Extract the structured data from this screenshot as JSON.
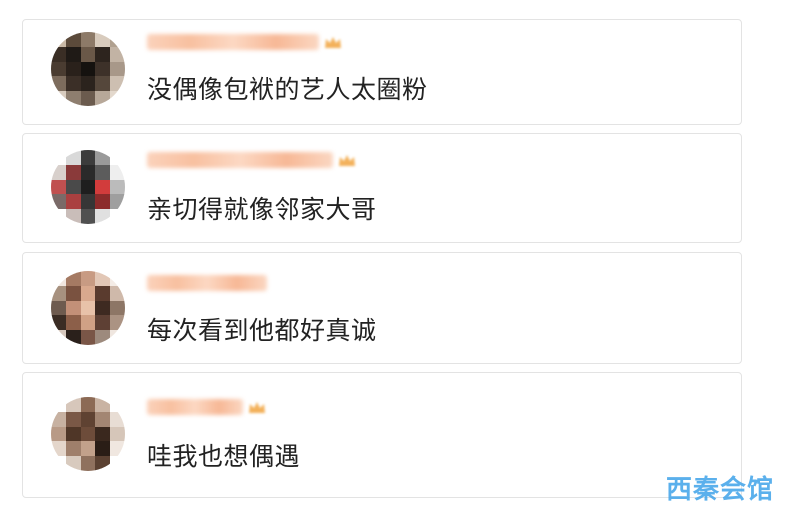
{
  "comments": [
    {
      "text": "没偶像包袱的艺人太圈粉",
      "username_redacted": true,
      "has_badge": true,
      "avatar": [
        "#c9b9a6",
        "#5b4a3a",
        "#8d7a68",
        "#d8cbbd",
        "#b0a08f",
        "#3a2e25",
        "#1f1a16",
        "#6a5848",
        "#2d241e",
        "#c2b3a4",
        "#4a3c31",
        "#2a211b",
        "#15120f",
        "#3d3129",
        "#a89889",
        "#7d6c5d",
        "#3b2f27",
        "#2b231d",
        "#55473b",
        "#cdbfb1",
        "#d9ccbf",
        "#8e7e6f",
        "#6b5b4e",
        "#b7a899",
        "#e3d8cc"
      ]
    },
    {
      "text": "亲切得就像邻家大哥",
      "username_redacted": true,
      "has_badge": true,
      "avatar": [
        "#ffffff",
        "#d9d9d9",
        "#3c3c3c",
        "#9a9a9a",
        "#ffffff",
        "#d8d0cc",
        "#8a3a3a",
        "#2a2a2a",
        "#5c5c5c",
        "#eeeeee",
        "#c05050",
        "#4a4a4a",
        "#1e1e1e",
        "#d23c3c",
        "#bbbbbb",
        "#7a6a68",
        "#aa4040",
        "#363636",
        "#8c2b2b",
        "#9f9f9f",
        "#ffffff",
        "#c9bdb9",
        "#505050",
        "#e0e0e0",
        "#ffffff"
      ]
    },
    {
      "text": "每次看到他都好真诚",
      "username_redacted": true,
      "has_badge": false,
      "avatar": [
        "#f1e6df",
        "#a57a63",
        "#c89b83",
        "#e2c7b6",
        "#f4ece6",
        "#a7917f",
        "#7a5240",
        "#d9a98e",
        "#5a3b2e",
        "#cfb9aa",
        "#6e5b4f",
        "#c39078",
        "#e8c2a9",
        "#3e2a21",
        "#8d7666",
        "#3a2c24",
        "#8c5f49",
        "#d0a185",
        "#5e4034",
        "#ab9383",
        "#d6c8be",
        "#2a201b",
        "#7a5647",
        "#9d8a7d",
        "#efe6df"
      ]
    },
    {
      "text": "哇我也想偶遇",
      "username_redacted": true,
      "has_badge": true,
      "avatar": [
        "#ffffff",
        "#d7c7bb",
        "#8c6a55",
        "#c9b3a3",
        "#ffffff",
        "#c7b1a1",
        "#7a5846",
        "#5f4232",
        "#a38673",
        "#e8ddd4",
        "#b89a86",
        "#4f3627",
        "#6d4c3a",
        "#3a281e",
        "#d6c6b9",
        "#e4d6cb",
        "#9f7f6b",
        "#c2a18b",
        "#2a1d16",
        "#f0e7e0",
        "#ffffff",
        "#d8cabe",
        "#8f715e",
        "#5b4132",
        "#ffffff"
      ]
    }
  ],
  "watermark": "西秦会馆"
}
